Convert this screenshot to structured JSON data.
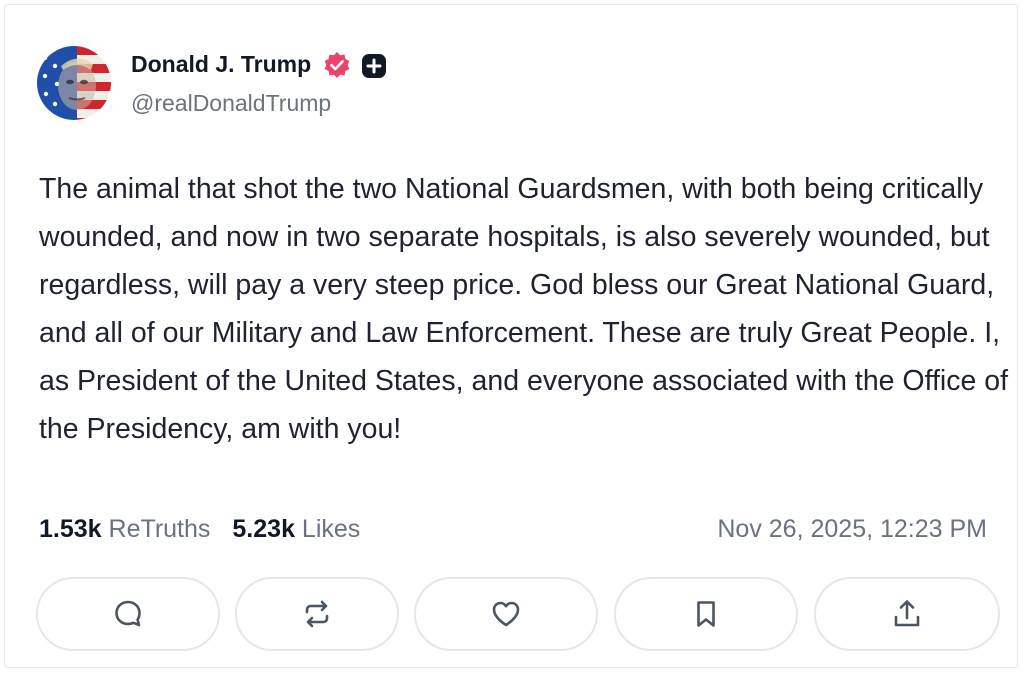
{
  "post": {
    "author": {
      "display_name": "Donald J. Trump",
      "handle": "@realDonaldTrump",
      "verified": true
    },
    "text": "The animal that shot the two National Guardsmen, with both being critically wounded, and now in two separate hospitals, is also severely wounded, but regardless, will pay a very steep price. God bless our Great National Guard, and all of our Military and Law Enforcement. These are truly Great People. I, as President of the United States, and everyone associated with the Office of the Presidency, am with you!",
    "stats": {
      "retruths_count": "1.53k",
      "retruths_label": "ReTruths",
      "likes_count": "5.23k",
      "likes_label": "Likes"
    },
    "timestamp": "Nov 26, 2025, 12:23 PM"
  },
  "actions": [
    {
      "icon": "reply-icon"
    },
    {
      "icon": "retruth-icon"
    },
    {
      "icon": "heart-icon"
    },
    {
      "icon": "bookmark-icon"
    },
    {
      "icon": "share-icon"
    }
  ],
  "colors": {
    "verified_badge": "#e8456a",
    "text_primary": "#1f2330",
    "text_secondary": "#6b7280",
    "border": "#e6e6eb"
  }
}
